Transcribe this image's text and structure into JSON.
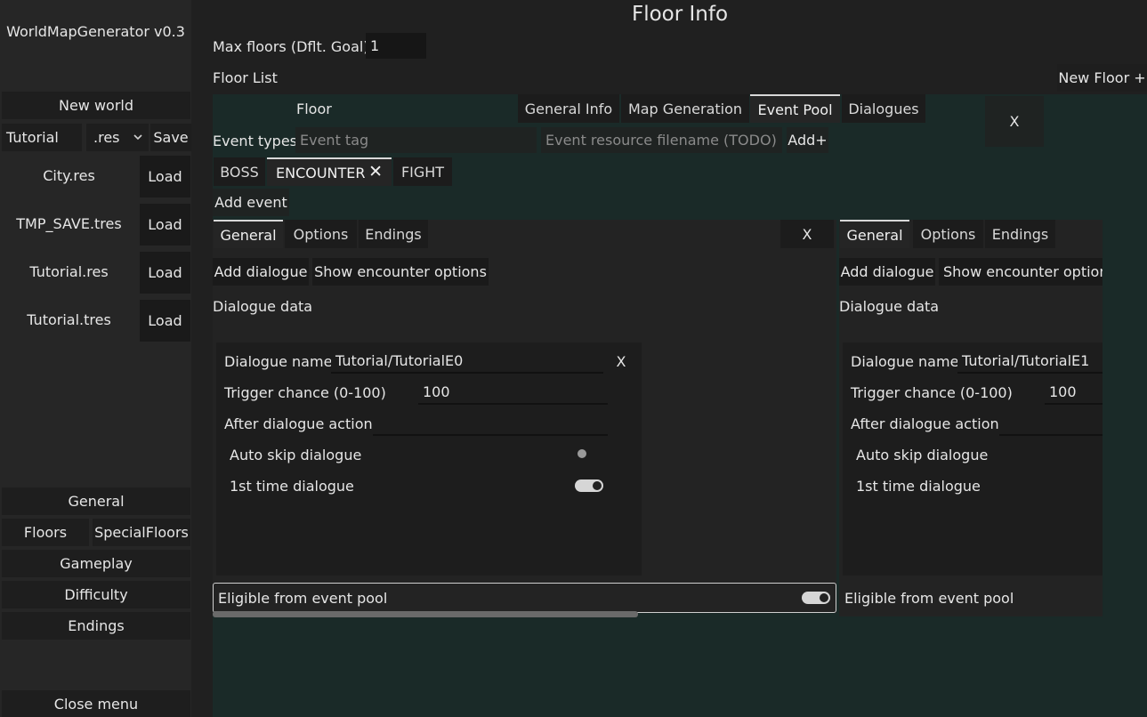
{
  "sidebar": {
    "title": "WorldMapGenerator v0.3",
    "new_world": "New world",
    "filename": "Tutorial",
    "extension": ".res",
    "save": "Save",
    "files": [
      {
        "name": "City.res",
        "load": "Load"
      },
      {
        "name": "TMP_SAVE.tres",
        "load": "Load"
      },
      {
        "name": "Tutorial.res",
        "load": "Load"
      },
      {
        "name": "Tutorial.tres",
        "load": "Load"
      }
    ],
    "menu": {
      "general": "General",
      "floors": "Floors",
      "special_floors": "SpecialFloors",
      "gameplay": "Gameplay",
      "difficulty": "Difficulty",
      "endings": "Endings"
    },
    "close_menu": "Close menu"
  },
  "main": {
    "title": "Floor Info",
    "max_floors_label": "Max floors (Dflt. Goal)",
    "max_floors_value": "1",
    "floor_list_label": "Floor List",
    "new_floor": "New Floor +"
  },
  "floor_panel": {
    "floor_label": "Floor",
    "tabs": [
      "General Info",
      "Map Generation",
      "Event Pool",
      "Dialogues"
    ],
    "active_tab": "Event Pool",
    "close": "X",
    "event_types_label": "Event types",
    "event_tag_placeholder": "Event tag",
    "event_resource_placeholder": "Event resource filename (TODO)",
    "add_button": "Add+",
    "event_tabs": [
      "BOSS",
      "ENCOUNTER",
      "FIGHT"
    ],
    "active_event_tab": "ENCOUNTER",
    "event_tab_close": "✕",
    "add_event": "Add event"
  },
  "event_cards": [
    {
      "tabs": [
        "General",
        "Options",
        "Endings"
      ],
      "close": "X",
      "add_dialogue": "Add dialogue",
      "show_options": "Show encounter options",
      "dialogue_data_label": "Dialogue data",
      "dialogue_name_label": "Dialogue name",
      "dialogue_name_value": "Tutorial/TutorialE0",
      "dialogue_close": "X",
      "trigger_chance_label": "Trigger chance (0-100)",
      "trigger_chance_value": "100",
      "after_action_label": "After dialogue action",
      "after_action_value": "",
      "auto_skip_label": "Auto skip dialogue",
      "first_time_label": "1st time dialogue",
      "eligible_label": "Eligible from event pool"
    },
    {
      "tabs": [
        "General",
        "Options",
        "Endings"
      ],
      "add_dialogue": "Add dialogue",
      "show_options": "Show encounter option",
      "dialogue_data_label": "Dialogue data",
      "dialogue_name_label": "Dialogue name",
      "dialogue_name_value": "Tutorial/TutorialE1",
      "trigger_chance_label": "Trigger chance (0-100)",
      "trigger_chance_value": "100",
      "after_action_label": "After dialogue action",
      "auto_skip_label": "Auto skip dialogue",
      "first_time_label": "1st time dialogue",
      "eligible_label": "Eligible from event pool"
    }
  ],
  "colors": {
    "panel_teal": "#1a2a28",
    "background": "#202020",
    "text": "#e6e6e6"
  }
}
